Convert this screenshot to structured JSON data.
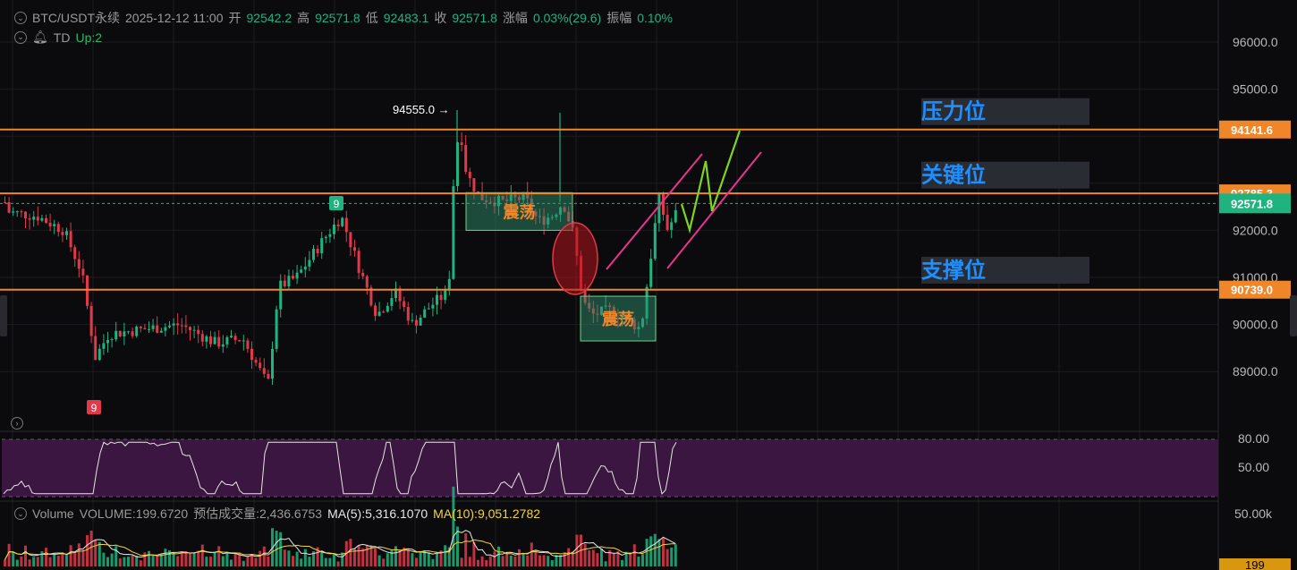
{
  "header": {
    "symbol": "BTC/USDT永续",
    "datetime": "2025-12-12 11:00",
    "open_label": "开",
    "open": "92542.2",
    "high_label": "高",
    "high": "92571.8",
    "low_label": "低",
    "low": "92483.1",
    "close_label": "收",
    "close": "92571.8",
    "change_label": "涨幅",
    "change": "0.03%(29.6)",
    "amplitude_label": "振幅",
    "amplitude": "0.10%",
    "td_label": "TD",
    "td_up": "Up:2"
  },
  "volume_header": {
    "label": "Volume",
    "volume": "VOLUME:199.6720",
    "estimate": "预估成交量:2,436.6753",
    "ma5": "MA(5):5,316.1070",
    "ma10": "MA(10):9,051.2782"
  },
  "colors": {
    "up": "#1fb37f",
    "down": "#e0394a",
    "level": "#f0862a",
    "zone_fill": "#2e8b6a",
    "zone_text": "#f0862a",
    "pink": "#e8358f",
    "green_line": "#7fd321",
    "rsi_band": "#3b1640",
    "label_blue": "#1e8fff"
  },
  "chart_data": {
    "type": "candlestick",
    "y_axis_ticks": [
      "96000.0",
      "95000.0",
      "92000.0",
      "91000.0",
      "90000.0",
      "89000.0"
    ],
    "price_range": [
      88200,
      96800
    ],
    "last_price": "92571.8",
    "levels": [
      {
        "price": 94141.6,
        "label": "94141.6"
      },
      {
        "price": 92785.3,
        "label": "92785.3"
      },
      {
        "price": 90739.0,
        "label": "90739.0"
      }
    ],
    "annotations": [
      {
        "text": "压力位",
        "price": 94200
      },
      {
        "text": "关键位",
        "price": 92850
      },
      {
        "text": "支撑位",
        "price": 90830
      }
    ],
    "high_marker": "94555.0",
    "zones": [
      {
        "text": "震荡",
        "price_top": 92800,
        "price_bottom": 92000
      },
      {
        "text": "震荡",
        "price_top": 90600,
        "price_bottom": 89650
      }
    ],
    "td_markers": [
      {
        "text": "9",
        "kind": "up"
      },
      {
        "text": "9",
        "kind": "down"
      }
    ],
    "rsi": {
      "ticks": [
        "80.00",
        "50.00"
      ]
    },
    "volume": {
      "ticks": [
        "50.00k"
      ],
      "last": "199"
    }
  }
}
